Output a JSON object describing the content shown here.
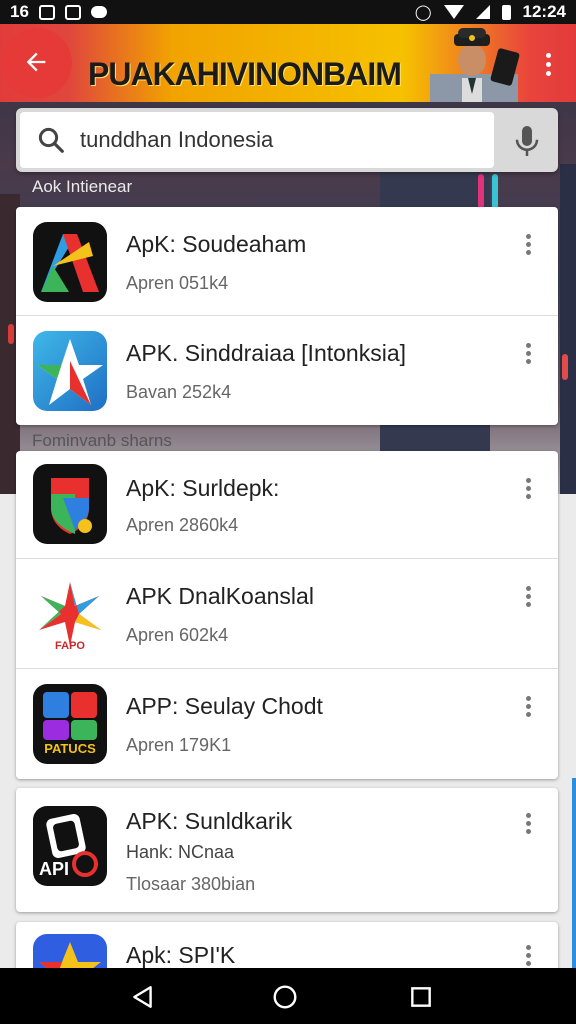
{
  "status_bar": {
    "left_text": "16",
    "time": "12:24"
  },
  "toolbar": {
    "title": "PUAKAHIVINONBAIM"
  },
  "search": {
    "value": "tunddhan Indonesia"
  },
  "sections": {
    "first": "Aok Intienear",
    "second": "Fominvanb sharns"
  },
  "featured_apps": [
    {
      "name": "ApK: Soudeaham",
      "sub": "Apren 051k4"
    },
    {
      "name": "APK. Sinddraiaa [Intonksia]",
      "sub": "Bavan 252k4"
    }
  ],
  "apps": [
    {
      "name": "ApK: Surldepk:",
      "sub": "Apren 2860k4"
    },
    {
      "name": "APK DnalKoanslal",
      "sub": "Apren 602k4"
    },
    {
      "name": "APP: Seulay Chodt",
      "sub": "Apren 179K1"
    },
    {
      "name": "APK: Sunldkarik",
      "sub": "Hank: NCnaa",
      "sub2": "Tlosaar 380bian"
    },
    {
      "name": "Apk: SPI'K"
    }
  ],
  "icon_labels": {
    "app4": "FAPO",
    "app5": "PATUCS",
    "app6": "API"
  },
  "icons": [
    "back-arrow-icon",
    "more-vert-icon",
    "search-icon",
    "microphone-icon",
    "back-triangle-icon",
    "home-circle-icon",
    "recents-square-icon"
  ],
  "colors": {
    "toolbar_red": "#e23b3b",
    "toolbar_yellow": "#f6c100",
    "accent_blue": "#2d8ee0"
  }
}
